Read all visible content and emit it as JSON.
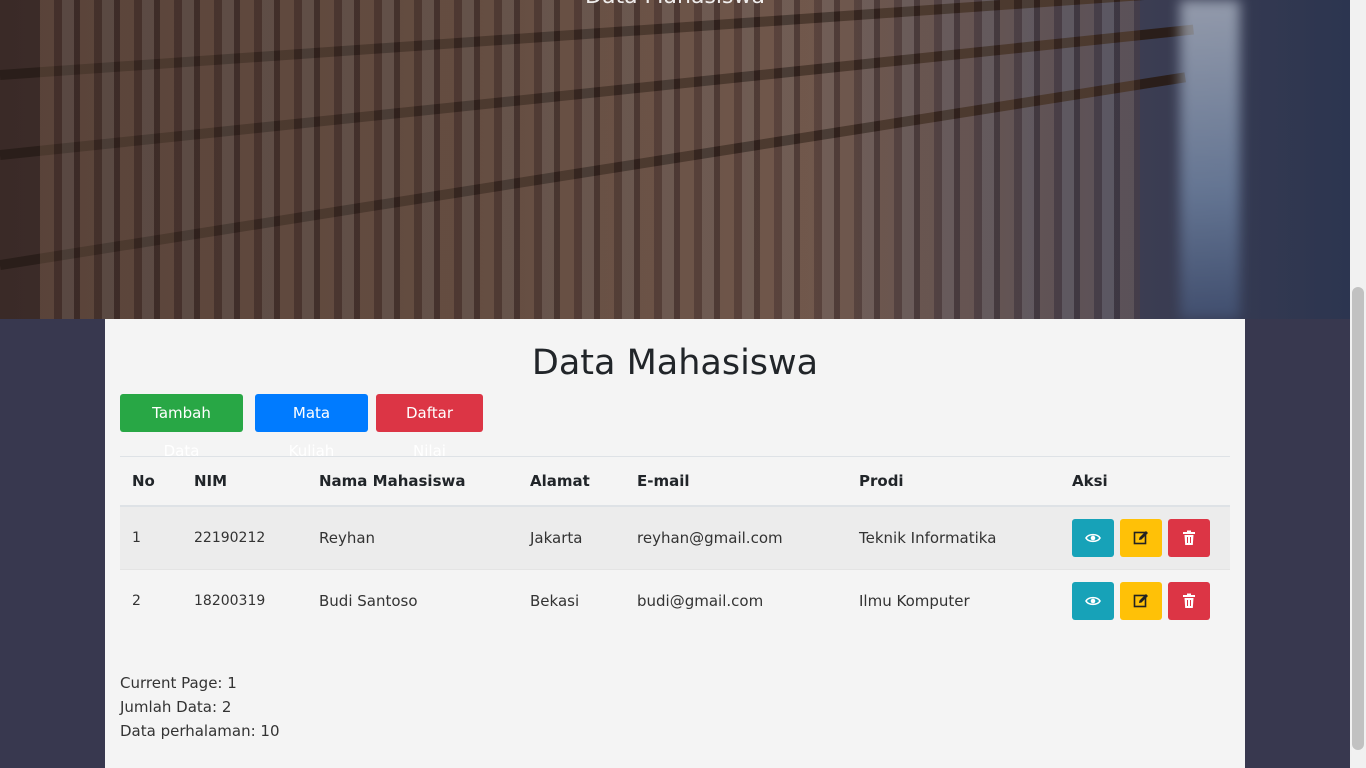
{
  "hero": {
    "title": "Data Mahasiswa"
  },
  "main": {
    "title": "Data Mahasiswa",
    "buttons": {
      "add": "Tambah Data",
      "courses": "Mata Kuliah",
      "grades": "Daftar Nilai"
    }
  },
  "table": {
    "headers": [
      "No",
      "NIM",
      "Nama Mahasiswa",
      "Alamat",
      "E-mail",
      "Prodi",
      "Aksi"
    ],
    "rows": [
      {
        "no": "1",
        "nim": "22190212",
        "nama": "Reyhan",
        "alamat": "Jakarta",
        "email": "reyhan@gmail.com",
        "prodi": "Teknik Informatika"
      },
      {
        "no": "2",
        "nim": "18200319",
        "nama": "Budi Santoso",
        "alamat": "Bekasi",
        "email": "budi@gmail.com",
        "prodi": "Ilmu Komputer"
      }
    ],
    "action_icons": [
      "eye-icon",
      "edit-icon",
      "trash-icon"
    ]
  },
  "pagination": {
    "current_page": "Current Page: 1",
    "total_data": "Jumlah Data: 2",
    "per_page": "Data perhalaman: 10"
  },
  "colors": {
    "success": "#28a745",
    "primary": "#007bff",
    "danger": "#dc3545",
    "info": "#17a2b8",
    "warning": "#ffc107",
    "page_bg": "#38384f"
  }
}
